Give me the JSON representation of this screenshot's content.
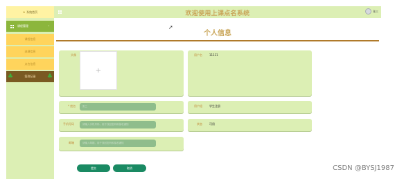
{
  "sidebar": {
    "home_label": "系统首页",
    "group_label": "课程管理",
    "items": [
      {
        "label": "课程信息"
      },
      {
        "label": "选课信息"
      },
      {
        "label": "点名信息"
      },
      {
        "label": "签到记录"
      }
    ]
  },
  "header": {
    "title": "欢迎使用上课点名系统",
    "user_label": "张三"
  },
  "page": {
    "title": "个人信息"
  },
  "profile": {
    "photo_label": "头像",
    "upload_symbol": "+",
    "username_label": "用户名",
    "username_value": "11111",
    "name_label": "* 姓名",
    "name_value": "张三",
    "role_label": "用户组",
    "role_value": "学生注册",
    "phone_label": "手机号码",
    "phone_placeholder": "请输入手机号码，用于找回密码和接收通知",
    "status_label": "状态",
    "status_value": "可用",
    "email_label": "邮箱",
    "email_placeholder": "请输入邮箱，用于找回密码和接收通知"
  },
  "actions": {
    "submit_label": "提交",
    "cancel_label": "取消"
  },
  "watermark": "CSDN @BYSJ1987"
}
